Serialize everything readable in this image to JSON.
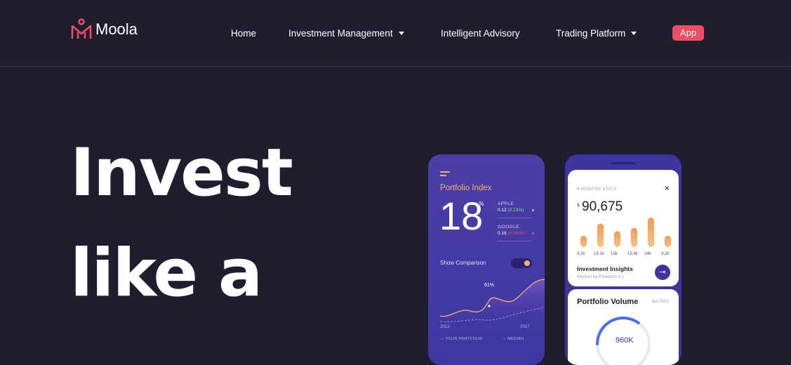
{
  "brand": {
    "name": "Moola",
    "logo_color": "#ee4d64"
  },
  "nav": {
    "items": [
      {
        "label": "Home"
      },
      {
        "label": "Investment Management",
        "dropdown": true
      },
      {
        "label": "Intelligent Advisory"
      },
      {
        "label": "Trading Platform",
        "dropdown": true
      }
    ],
    "app_button": "App"
  },
  "hero": {
    "line1": "Invest",
    "line2": "like a"
  },
  "phone1": {
    "title": "Portfolio Index",
    "big_value": "18",
    "pct_symbol": "%",
    "stocks": [
      {
        "name": "APPLE",
        "value": "0.12",
        "change": "(0.13%)",
        "trend": "up"
      },
      {
        "name": "GOOGLE",
        "value": "0.16",
        "change": "(0.06%)",
        "trend": "down"
      }
    ],
    "compare_label": "Show Comparison",
    "peak_label": "61%",
    "year_start": "2013",
    "year_end": "2017",
    "legend_portfolio": "YOUR PORTFOLIO",
    "legend_median": "MEDIAN"
  },
  "phone2": {
    "stats_label": "6 MONTHS STATS",
    "close_glyph": "×",
    "currency": "$",
    "amount": "90,675",
    "bars": [
      {
        "label": "9.2k",
        "value": 9.2
      },
      {
        "label": "19.1k",
        "value": 19.1
      },
      {
        "label": "13k",
        "value": 13
      },
      {
        "label": "15.6k",
        "value": 15.6
      },
      {
        "label": "24k",
        "value": 24
      },
      {
        "label": "9.2k",
        "value": 9.2
      }
    ],
    "insights_title": "Investment Insights",
    "insights_sub": "Advices by Prediction A.I.",
    "arrow_glyph": "→",
    "volume_title": "Portfolio Volume",
    "volume_date": "Jun 2019",
    "volume_value": "960K",
    "gauge_fraction": 0.35
  }
}
